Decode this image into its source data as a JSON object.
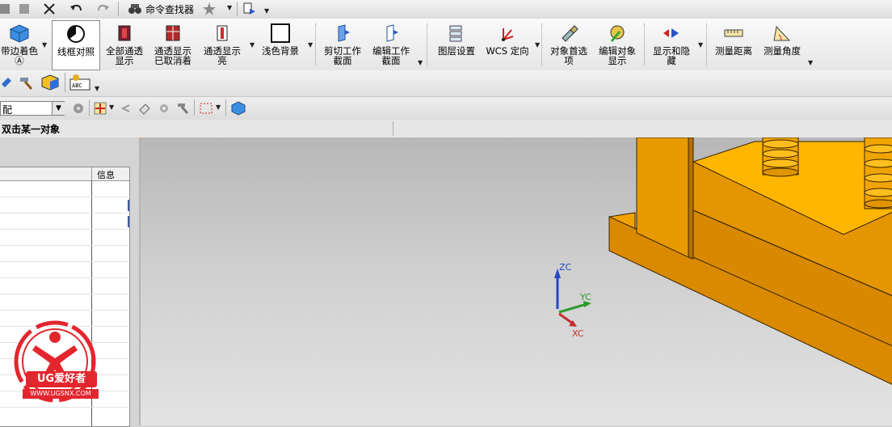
{
  "quickbar": {
    "command_finder_label": "命令查找器"
  },
  "ribbon": {
    "buttons": [
      {
        "label_lines": [
          "带边着色",
          "Ⓐ"
        ],
        "icon": "shaded-with-edges-icon"
      },
      {
        "label_lines": [
          "线框对照"
        ],
        "icon": "wireframe-compare-icon",
        "selected": true
      },
      {
        "label_lines": [
          "全部通透",
          "显示"
        ],
        "icon": "see-through-all-icon"
      },
      {
        "label_lines": [
          "通透显示",
          "已取消着"
        ],
        "icon": "see-through-cancel-icon"
      },
      {
        "label_lines": [
          "通透显示",
          "亮"
        ],
        "icon": "see-through-highlight-icon"
      },
      {
        "label_lines": [
          "浅色背景"
        ],
        "icon": "light-background-icon"
      },
      {
        "label_lines": [
          "剪切工作",
          "截面"
        ],
        "icon": "clip-section-icon"
      },
      {
        "label_lines": [
          "编辑工作",
          "截面"
        ],
        "icon": "edit-section-icon"
      },
      {
        "label_lines": [
          "图层设置"
        ],
        "icon": "layer-settings-icon"
      },
      {
        "label_lines": [
          "WCS 定向"
        ],
        "icon": "wcs-orient-icon"
      },
      {
        "label_lines": [
          "对象首选",
          "项"
        ],
        "icon": "object-preferences-icon"
      },
      {
        "label_lines": [
          "编辑对象",
          "显示"
        ],
        "icon": "edit-object-display-icon"
      },
      {
        "label_lines": [
          "显示和隐",
          "藏"
        ],
        "icon": "show-hide-icon"
      },
      {
        "label_lines": [
          "测量距离"
        ],
        "icon": "measure-distance-icon"
      },
      {
        "label_lines": [
          "测量角度"
        ],
        "icon": "measure-angle-icon"
      }
    ]
  },
  "selection_bar": {
    "filter_value": "配"
  },
  "cue_line": {
    "text": "双击某一对象"
  },
  "navigator": {
    "column_info": "信息"
  },
  "triad": {
    "zc": "ZC",
    "yc": "YC",
    "xc": "XC"
  },
  "watermark": {
    "brand": "UG爱好者",
    "url": "WWW.UGSNX.COM"
  },
  "colors": {
    "model_face_top": "#ffb400",
    "model_face_front": "#d88a00",
    "model_edge": "#3b2500",
    "axis_z": "#2446c6",
    "axis_y": "#2c9a2c",
    "axis_x": "#c62d2d"
  }
}
